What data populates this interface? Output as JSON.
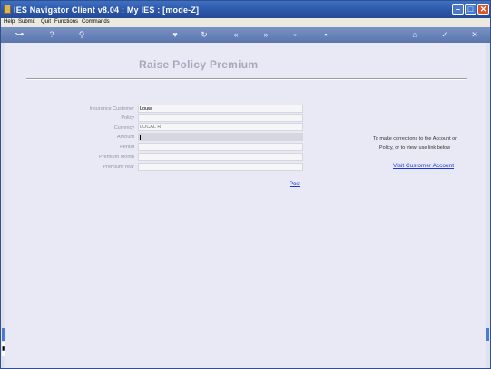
{
  "window": {
    "title": "IES Navigator Client v8.04 : My IES :     [mode-Z]"
  },
  "menu": {
    "items": [
      "Help",
      "Submit",
      "Quit",
      "Functions",
      "Commands"
    ]
  },
  "toolbar": {
    "icons": [
      "key-icon",
      "help-icon",
      "search-icon",
      "heart-icon",
      "refresh-icon",
      "back-icon",
      "forward-icon",
      "document-icon",
      "save-icon",
      "home-icon",
      "ok-icon",
      "close-icon"
    ]
  },
  "page": {
    "title": "Raise Policy Premium"
  },
  "form": {
    "fields": [
      {
        "label": "Insurance Customer",
        "value": "Louw"
      },
      {
        "label": "Policy",
        "value": ""
      },
      {
        "label": "Currency",
        "value": "LOCAL  R"
      },
      {
        "label": "Amount",
        "value": ""
      },
      {
        "label": "Period",
        "value": ""
      },
      {
        "label": "Premium Month",
        "value": ""
      },
      {
        "label": "Premium Year",
        "value": ""
      }
    ],
    "post_label": "Post"
  },
  "side": {
    "note_line1": "To make corrections to the Account or",
    "note_line2": "Policy, or to view, use link below",
    "link_label": "Visit Customer Account"
  },
  "colors": {
    "titlebar": "#2b55a6",
    "toolbar": "#5a76ae",
    "content_bg": "#e8e9f4",
    "link": "#1c39d6",
    "close_button": "#d9532c"
  }
}
